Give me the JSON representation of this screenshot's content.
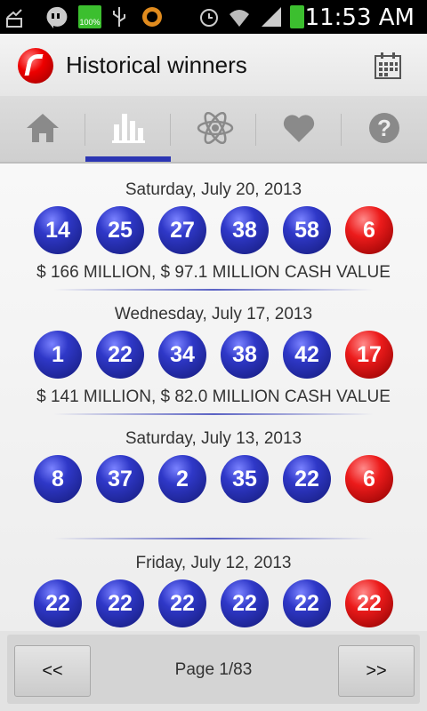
{
  "status_bar": {
    "time": "11:53 AM",
    "battery_percent_label": "100%"
  },
  "app": {
    "title": "Historical winners"
  },
  "tabs": [
    {
      "name": "home",
      "icon": "home-icon"
    },
    {
      "name": "results",
      "icon": "bar-chart-icon",
      "active": true
    },
    {
      "name": "atom",
      "icon": "atom-icon"
    },
    {
      "name": "favorites",
      "icon": "heart-icon"
    },
    {
      "name": "help",
      "icon": "help-icon"
    }
  ],
  "draws": [
    {
      "date": "Saturday, July 20, 2013",
      "balls": [
        "14",
        "25",
        "27",
        "38",
        "58"
      ],
      "powerball": "6",
      "prize": "$ 166 MILLION, $ 97.1 MILLION CASH VALUE"
    },
    {
      "date": "Wednesday, July 17, 2013",
      "balls": [
        "1",
        "22",
        "34",
        "38",
        "42"
      ],
      "powerball": "17",
      "prize": "$ 141 MILLION, $ 82.0 MILLION CASH VALUE"
    },
    {
      "date": "Saturday, July 13, 2013",
      "balls": [
        "8",
        "37",
        "2",
        "35",
        "22"
      ],
      "powerball": "6",
      "prize": ""
    },
    {
      "date": "Friday, July 12, 2013",
      "balls": [
        "22",
        "22",
        "22",
        "22",
        "22"
      ],
      "powerball": "22",
      "prize": ""
    }
  ],
  "pager": {
    "prev_label": "<<",
    "next_label": ">>",
    "page_label": "Page 1/83"
  },
  "colors": {
    "accent": "#2c36b3",
    "ball_white": "#2f38c8",
    "ball_power": "#ec1b1b"
  }
}
